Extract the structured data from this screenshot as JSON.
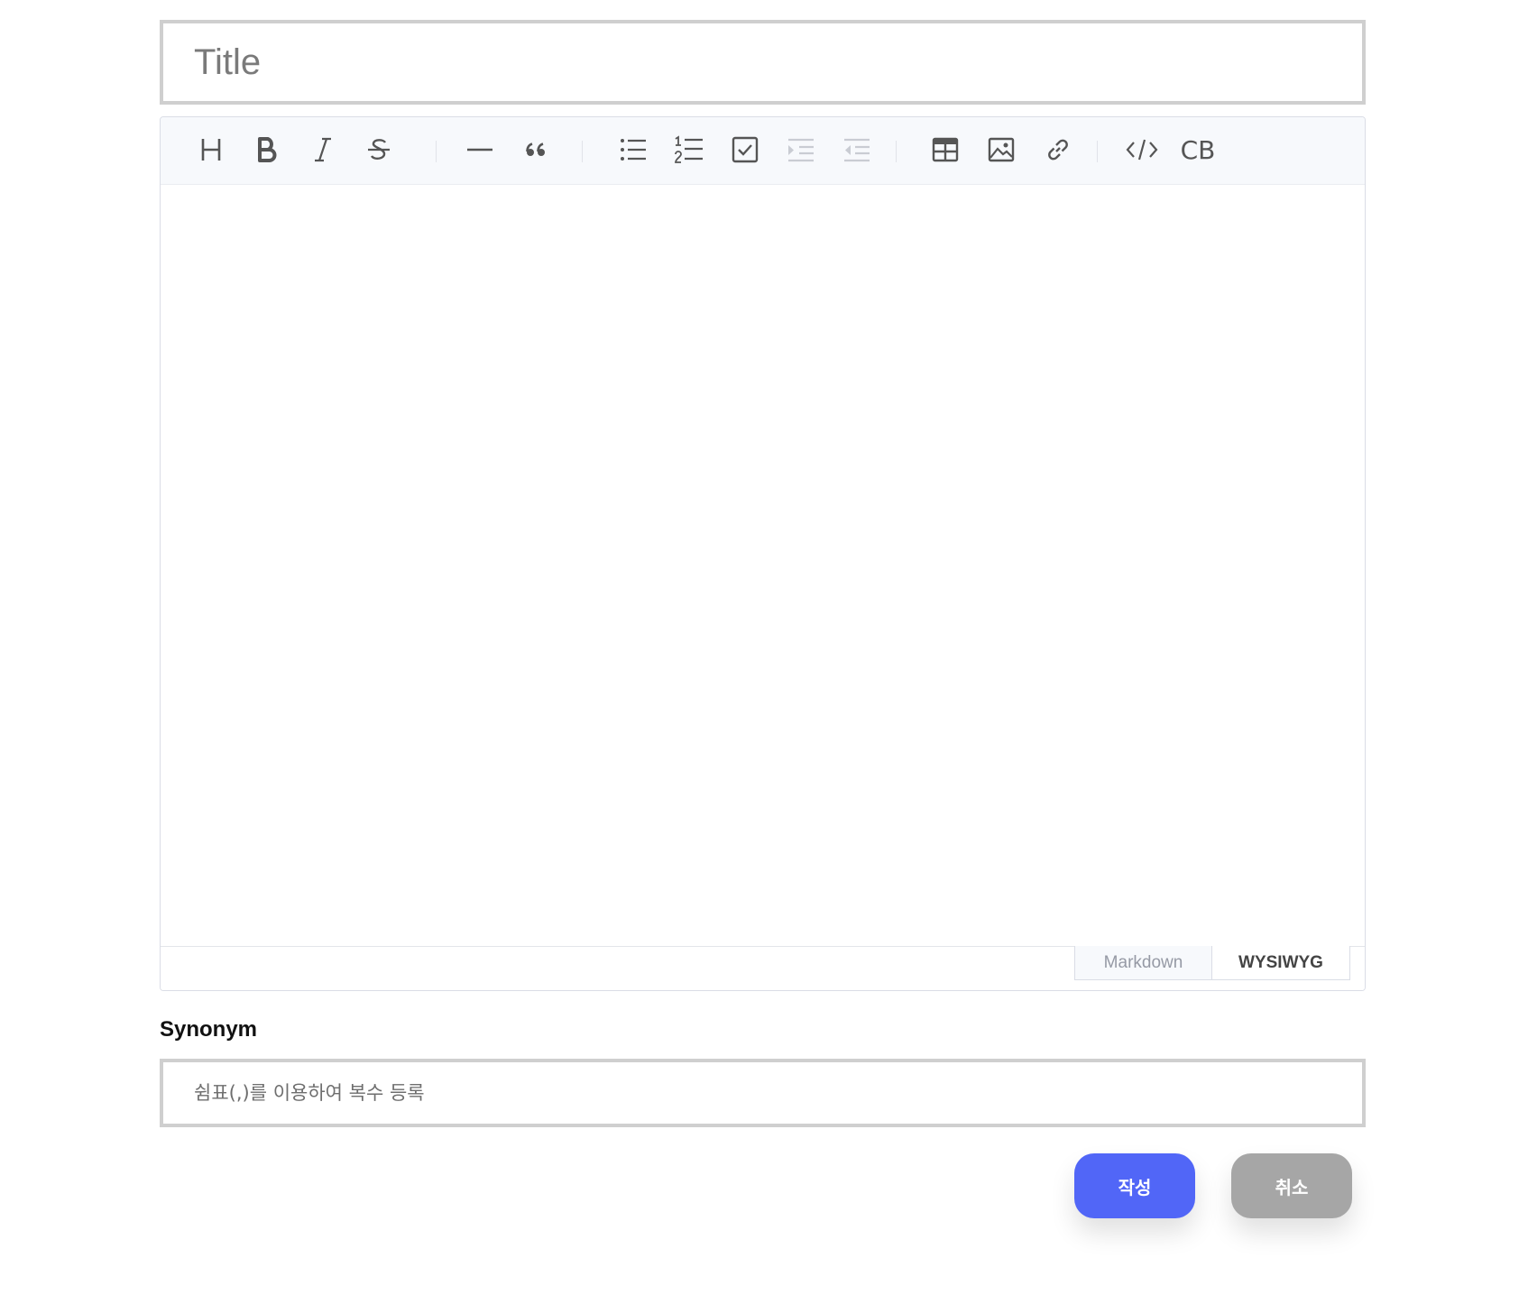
{
  "title_input": {
    "placeholder": "Title",
    "value": ""
  },
  "editor": {
    "toolbar": [
      {
        "name": "heading",
        "icon": "heading-icon"
      },
      {
        "name": "bold",
        "icon": "bold-icon"
      },
      {
        "name": "italic",
        "icon": "italic-icon"
      },
      {
        "name": "strike",
        "icon": "strikethrough-icon"
      },
      {
        "name": "hr",
        "icon": "horizontal-rule-icon"
      },
      {
        "name": "quote",
        "icon": "quote-icon"
      },
      {
        "name": "bullet-list",
        "icon": "bullet-list-icon"
      },
      {
        "name": "ordered-list",
        "icon": "ordered-list-icon"
      },
      {
        "name": "task-list",
        "icon": "task-list-icon"
      },
      {
        "name": "indent",
        "icon": "indent-icon",
        "disabled": true
      },
      {
        "name": "outdent",
        "icon": "outdent-icon",
        "disabled": true
      },
      {
        "name": "table",
        "icon": "table-icon"
      },
      {
        "name": "image",
        "icon": "image-icon"
      },
      {
        "name": "link",
        "icon": "link-icon"
      },
      {
        "name": "code",
        "icon": "code-icon"
      },
      {
        "name": "codeblock",
        "icon": "code-block-icon",
        "label": "CB"
      }
    ],
    "modes": {
      "markdown": "Markdown",
      "wysiwyg": "WYSIWYG",
      "active": "WYSIWYG"
    },
    "content": ""
  },
  "synonym": {
    "label": "Synonym",
    "placeholder": "쉼표(,)를 이용하여 복수 등록",
    "value": ""
  },
  "buttons": {
    "submit": "작성",
    "cancel": "취소"
  },
  "colors": {
    "submit": "#5166f7",
    "cancel": "#a6a6a6",
    "toolbar_bg": "#f7f9fc",
    "input_border": "#cfcfcf"
  }
}
